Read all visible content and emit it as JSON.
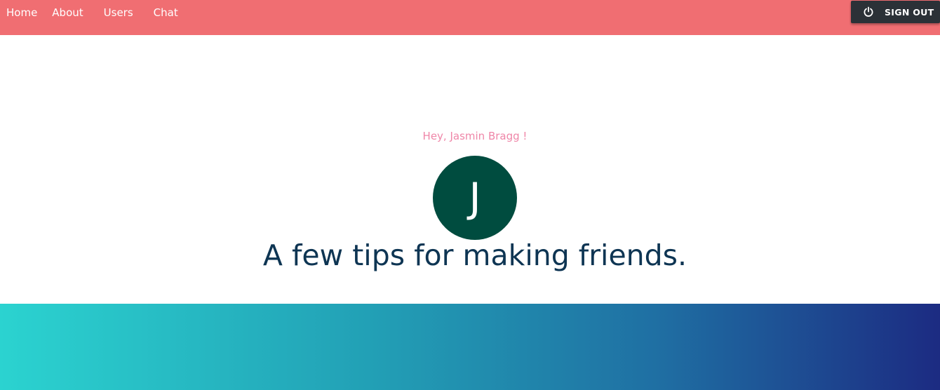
{
  "nav": {
    "links": [
      {
        "label": "Home"
      },
      {
        "label": "About"
      },
      {
        "label": "Users"
      },
      {
        "label": "Chat"
      }
    ],
    "signout": {
      "label": "SIGN OUT",
      "icon": "power-icon"
    }
  },
  "main": {
    "greeting": "Hey, Jasmin Bragg !",
    "avatar_initial": "J",
    "heading": "A few tips for making friends."
  },
  "colors": {
    "navbar": "#f06e72",
    "signout_bg": "#2b3137",
    "greeting": "#ef86a8",
    "avatar_bg": "#004c3f",
    "heading": "#0e3553",
    "gradient_start": "#2bd3d0",
    "gradient_end": "#1c2b82"
  }
}
